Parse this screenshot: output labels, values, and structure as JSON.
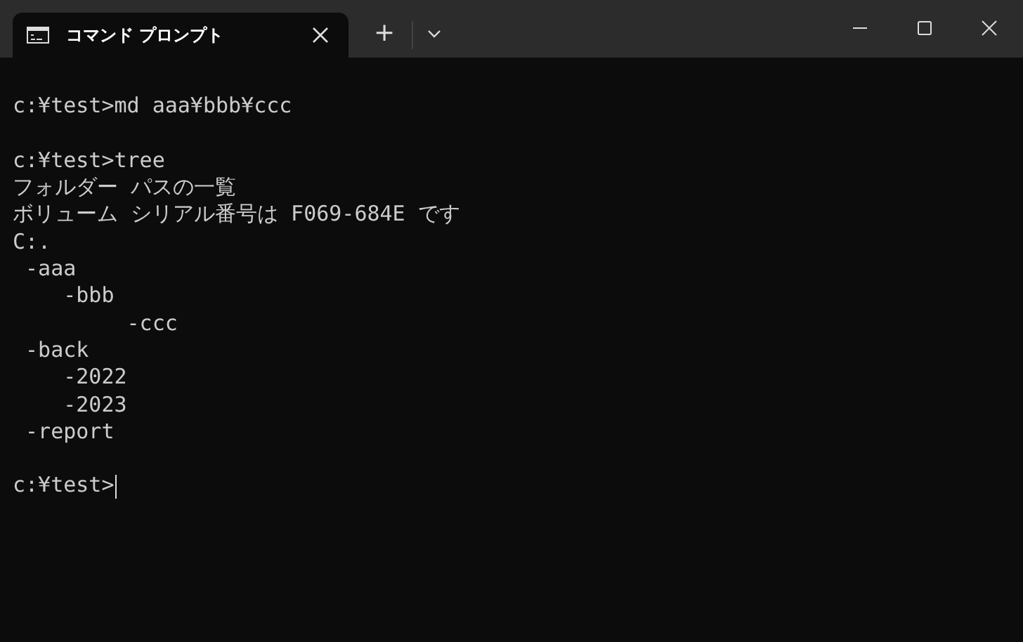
{
  "window": {
    "tab": {
      "title": "コマンド プロンプト",
      "selected": true
    },
    "new_tab": "+"
  },
  "terminal": {
    "before": [
      {
        "kind": "gap"
      },
      {
        "kind": "text",
        "text": "c:¥test>md aaa¥bbb¥ccc"
      },
      {
        "kind": "gap"
      },
      {
        "kind": "text",
        "text": "c:¥test>tree"
      },
      {
        "kind": "text",
        "text": "フォルダー パスの一覧"
      },
      {
        "kind": "text",
        "text": "ボリューム シリアル番号は F069-684E です"
      },
      {
        "kind": "text",
        "text": "C:."
      }
    ],
    "tree": [
      {
        "name": "-aaa",
        "children": [
          {
            "name": "-bbb",
            "children": [
              {
                "name": "-ccc"
              }
            ]
          }
        ]
      },
      {
        "name": "-back",
        "children": [
          {
            "name": "-2022"
          },
          {
            "name": "-2023"
          }
        ]
      },
      {
        "name": "-report"
      }
    ],
    "after": [
      {
        "kind": "gap"
      },
      {
        "kind": "text",
        "text": "c:¥test>"
      }
    ]
  }
}
